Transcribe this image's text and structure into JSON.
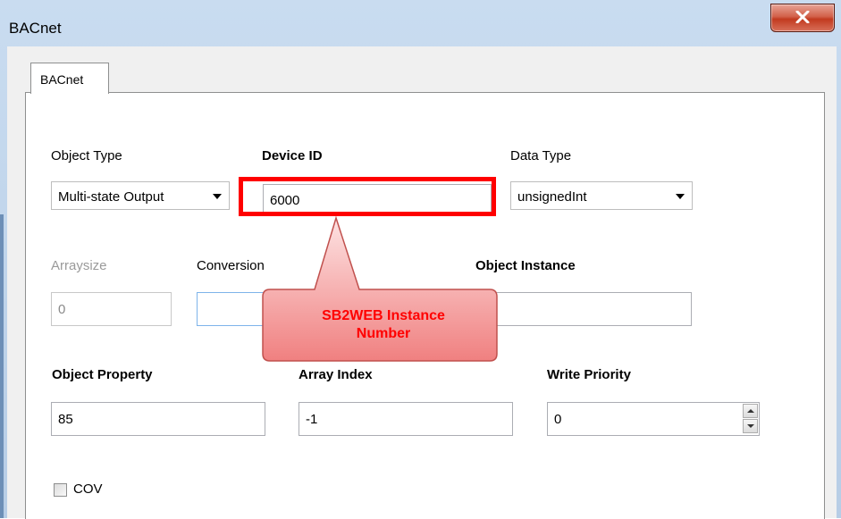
{
  "window": {
    "title": "BACnet",
    "close_icon": "close-x-icon",
    "accent_close": "#c23a1f"
  },
  "tabs": [
    {
      "label": "BACnet",
      "selected": true
    }
  ],
  "fields": {
    "object_type": {
      "label": "Object Type",
      "value": "Multi-state Output"
    },
    "device_id": {
      "label": "Device ID",
      "value": "6000"
    },
    "data_type": {
      "label": "Data Type",
      "value": "unsignedInt"
    },
    "arraysize": {
      "label": "Arraysize",
      "value": "0"
    },
    "conversion": {
      "label": "Conversion",
      "value": ""
    },
    "object_instance": {
      "label": "Object Instance",
      "value": ""
    },
    "object_property": {
      "label": "Object Property",
      "value": "85"
    },
    "array_index": {
      "label": "Array Index",
      "value": "-1"
    },
    "write_priority": {
      "label": "Write Priority",
      "value": "0"
    },
    "cov": {
      "label": "COV",
      "checked": false
    }
  },
  "annotation": {
    "callout_line1": "SB2WEB Instance",
    "callout_line2": "Number",
    "highlight_color": "#ff0000"
  }
}
